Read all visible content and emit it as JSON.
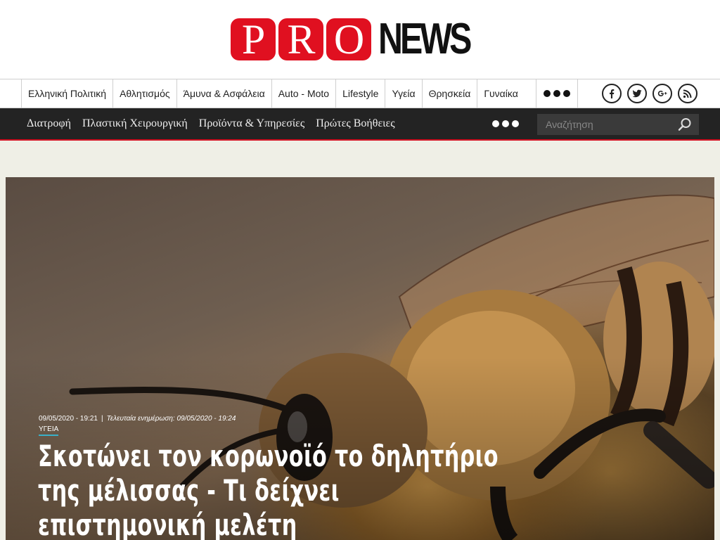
{
  "logo": {
    "pro_letters": [
      "P",
      "R",
      "O"
    ],
    "news": "NEWS",
    "brand_color": "#e01020"
  },
  "topnav": {
    "items": [
      "Ελληνική Πολιτική",
      "Αθλητισμός",
      "Άμυνα & Ασφάλεια",
      "Auto - Moto",
      "Lifestyle",
      "Υγεία",
      "Θρησκεία",
      "Γυναίκα"
    ],
    "more_icon": "more-dots-icon",
    "social": [
      "facebook-icon",
      "twitter-icon",
      "google-plus-icon",
      "rss-icon"
    ]
  },
  "subnav": {
    "items": [
      "Διατροφή",
      "Πλαστική Χειρουργική",
      "Προϊόντα & Υπηρεσίες",
      "Πρώτες Βοήθειες"
    ],
    "more_icon": "more-dots-icon",
    "search_placeholder": "Αναζήτηση",
    "accent": "#d01020"
  },
  "hero": {
    "date": "09/05/2020 - 19:21",
    "separator": "|",
    "updated": "Τελευταία ενημέρωση: 09/05/2020 - 19:24",
    "category": "ΥΓΕΙΑ",
    "headline_lines": [
      "Σκοτώνει τον κορωνοϊό το δηλητήριο",
      "της μέλισσας - Τι δείχνει",
      "επιστημονική μελέτη"
    ]
  }
}
